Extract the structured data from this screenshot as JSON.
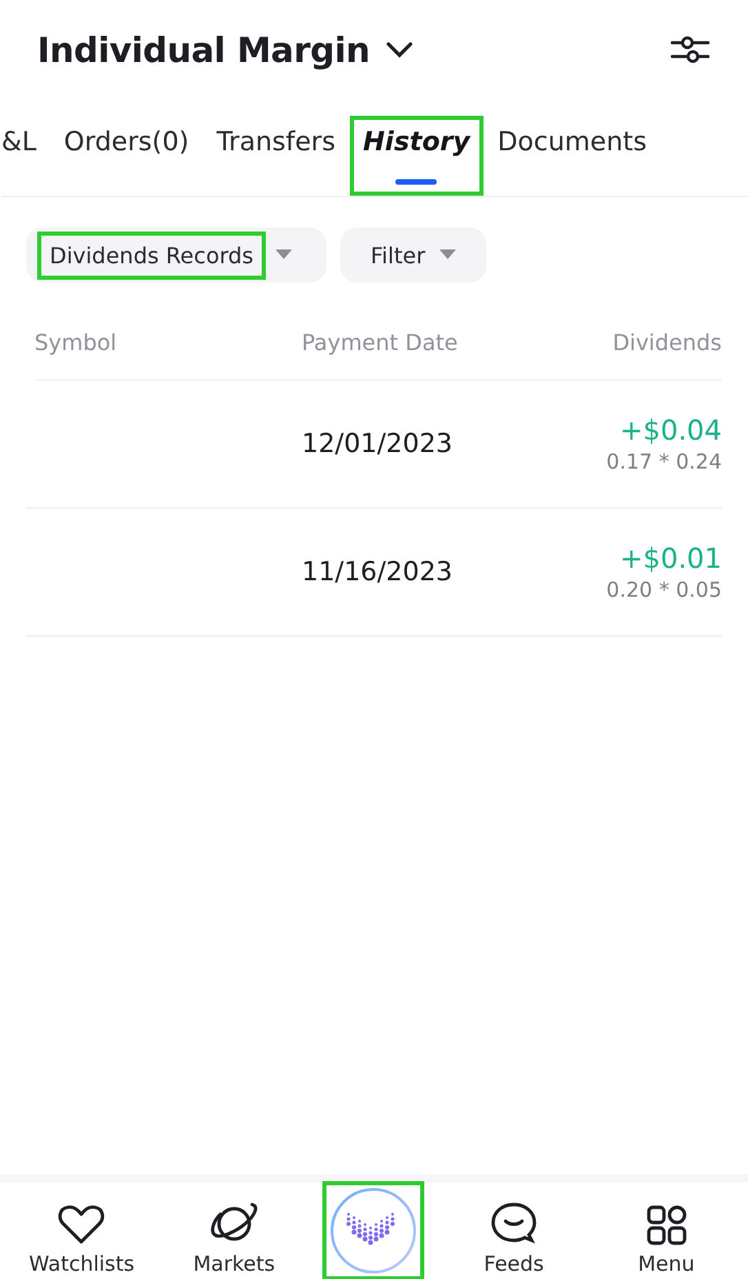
{
  "header": {
    "title": "Individual Margin"
  },
  "tabs": [
    {
      "label": "&L",
      "selected": false,
      "highlighted": false
    },
    {
      "label": "Orders(0)",
      "selected": false,
      "highlighted": false
    },
    {
      "label": "Transfers",
      "selected": false,
      "highlighted": false
    },
    {
      "label": "History",
      "selected": true,
      "highlighted": true
    },
    {
      "label": "Documents",
      "selected": false,
      "highlighted": false
    }
  ],
  "filters": [
    {
      "label": "Dividends Records",
      "highlighted": true
    },
    {
      "label": "Filter",
      "highlighted": false
    }
  ],
  "table": {
    "columns": [
      "Symbol",
      "Payment Date",
      "Dividends"
    ],
    "rows": [
      {
        "date": "12/01/2023",
        "amount": "+$0.04",
        "detail": "0.17 * 0.24"
      },
      {
        "date": "11/16/2023",
        "amount": "+$0.01",
        "detail": "0.20 * 0.05"
      }
    ]
  },
  "nav": [
    {
      "kind": "heart",
      "label": "Watchlists",
      "highlighted": false
    },
    {
      "kind": "planet",
      "label": "Markets",
      "highlighted": false
    },
    {
      "kind": "logo",
      "highlighted": true
    },
    {
      "kind": "chat",
      "label": "Feeds",
      "highlighted": false
    },
    {
      "kind": "grid",
      "label": "Menu",
      "highlighted": false
    }
  ]
}
